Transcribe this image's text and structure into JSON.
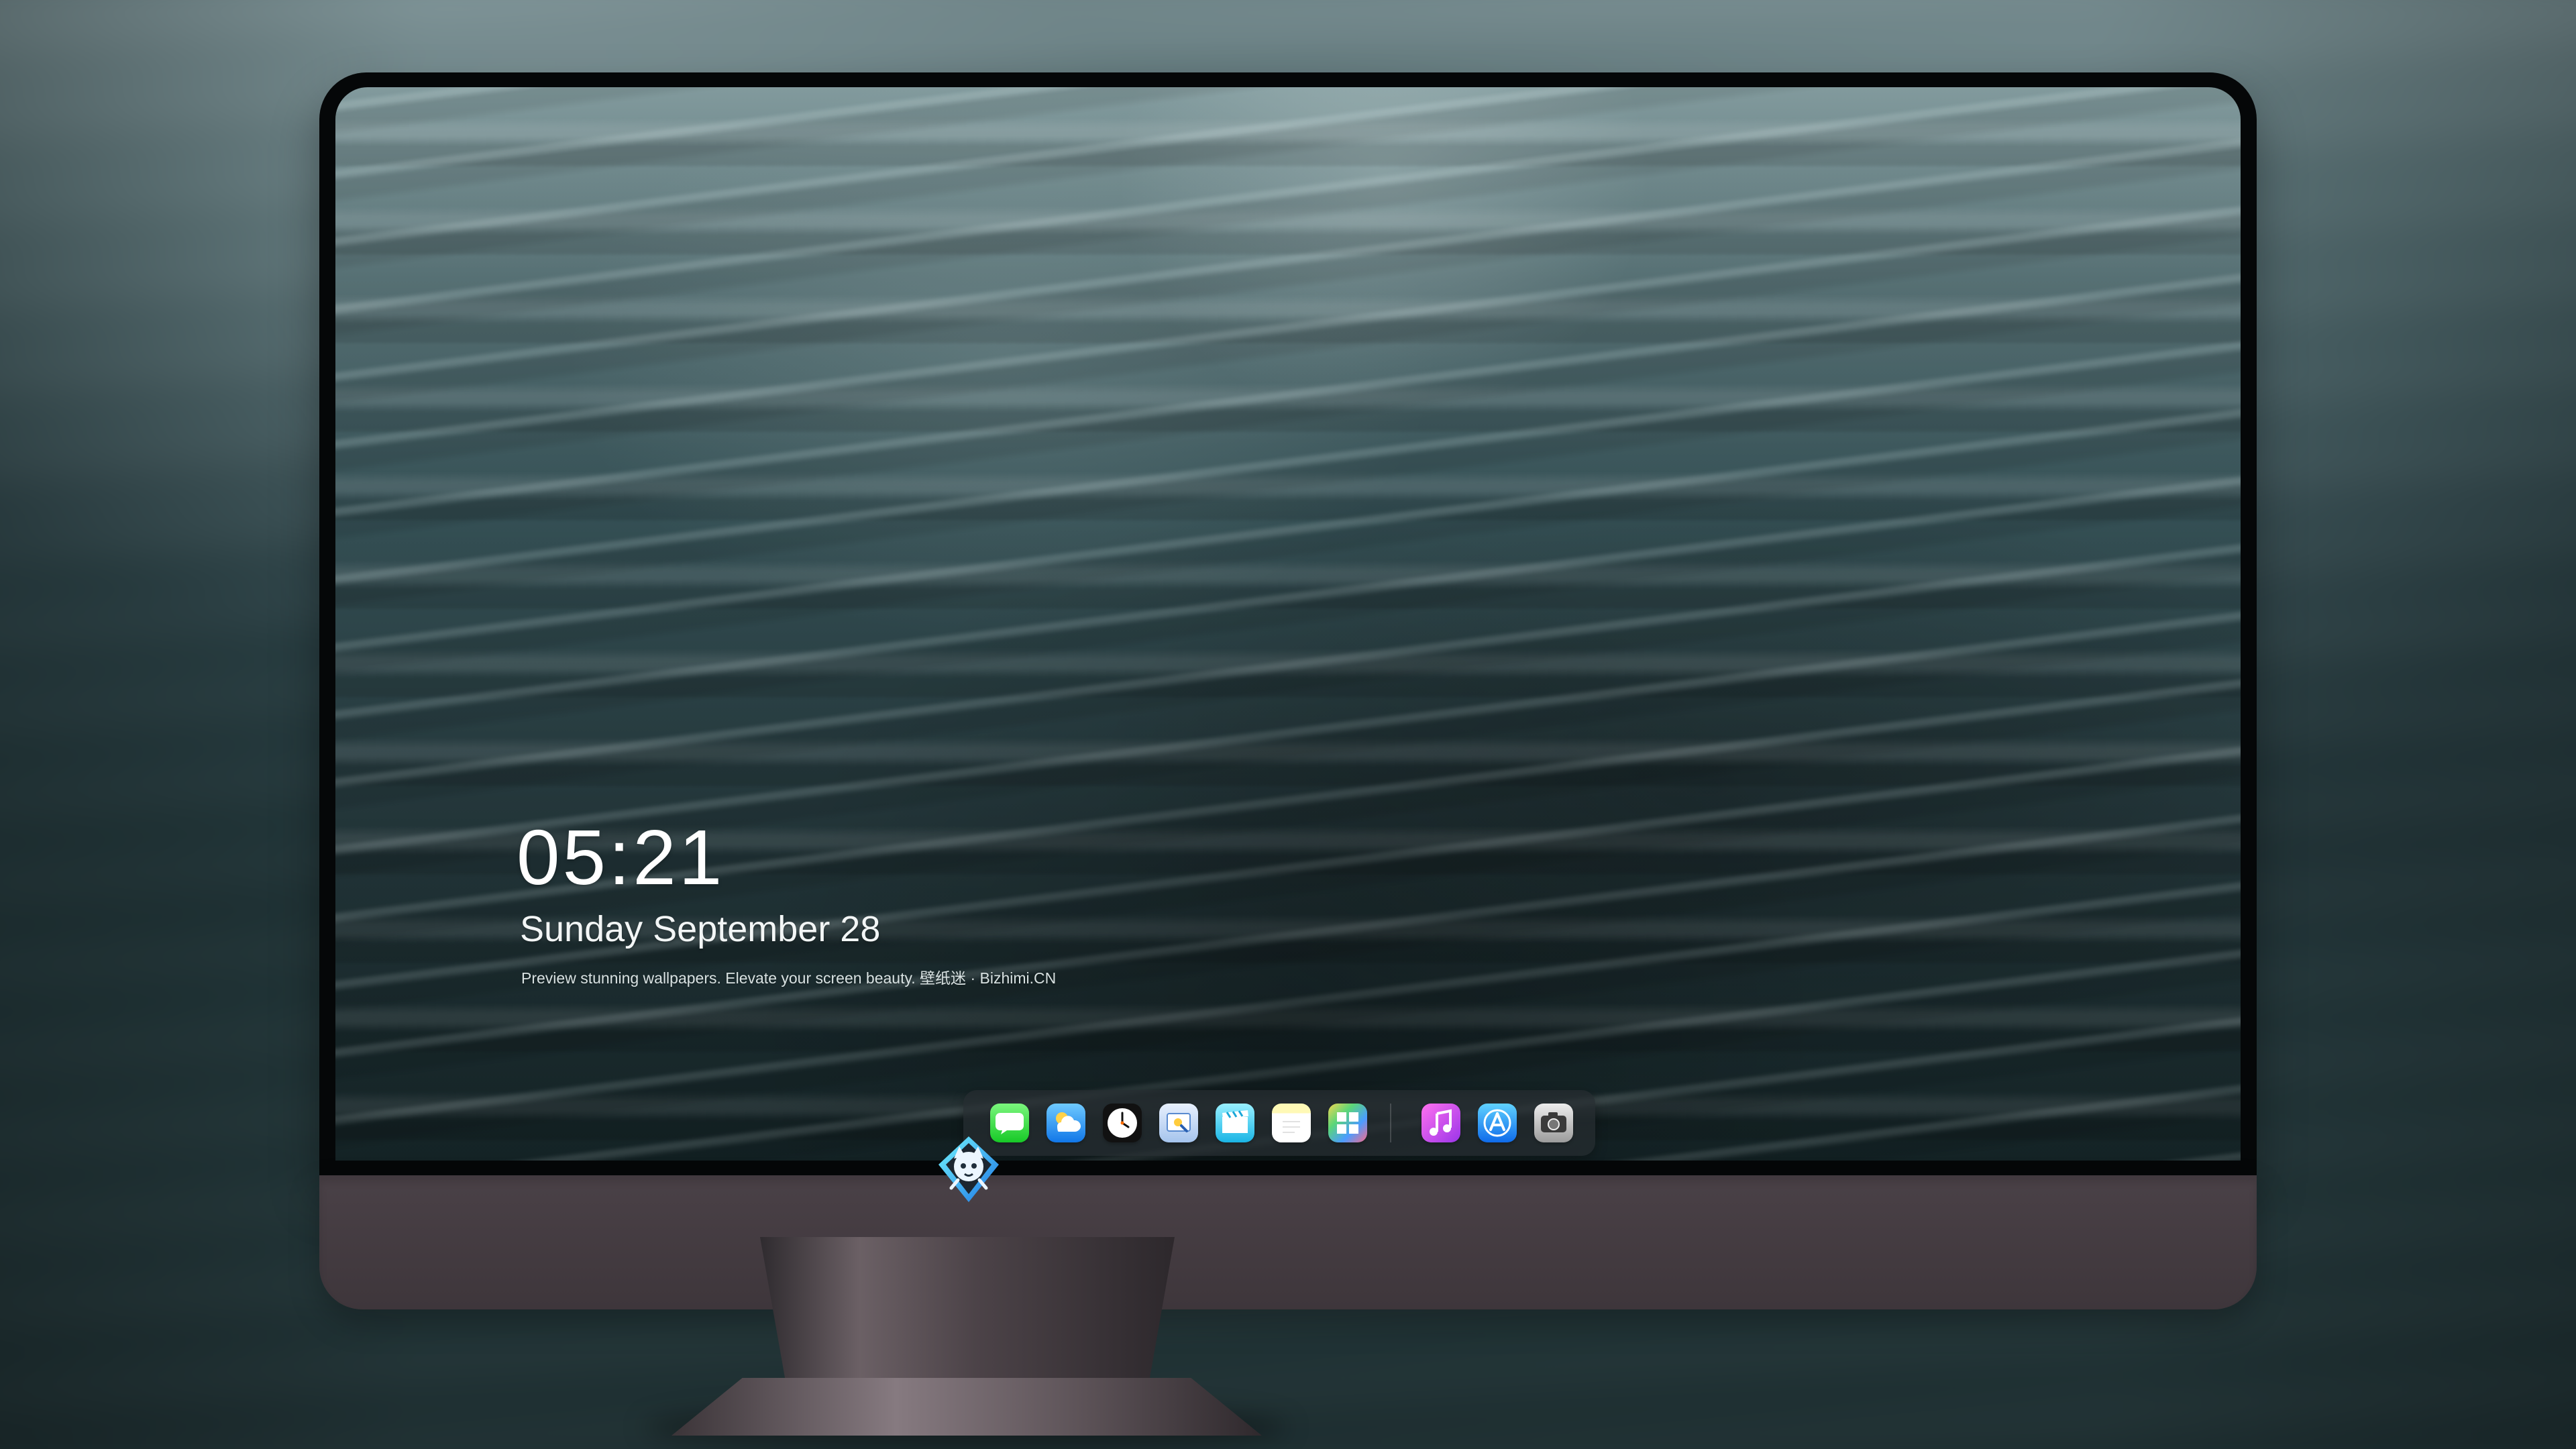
{
  "lock_screen": {
    "time": "05:21",
    "date": "Sunday September  28",
    "caption": "Preview stunning wallpapers. Elevate your screen beauty. 壁纸迷 · Bizhimi.CN"
  },
  "dock": {
    "apps": [
      {
        "name": "messages-icon",
        "color": "#24D336"
      },
      {
        "name": "weather-icon",
        "color": "#2A8DF2"
      },
      {
        "name": "clock-icon",
        "color": "#111111"
      },
      {
        "name": "preview-icon",
        "color": "#D8E6FB"
      },
      {
        "name": "clips-icon",
        "color": "#30C4EA"
      },
      {
        "name": "notes-icon",
        "color": "#FFF0A0"
      },
      {
        "name": "photo-gallery-icon",
        "color": "#5BD678"
      },
      {
        "name": "music-icon",
        "color": "#C84CF0"
      },
      {
        "name": "app-store-icon",
        "color": "#1E86F0"
      },
      {
        "name": "camera-icon",
        "color": "#C8C8C8"
      }
    ]
  },
  "device": {
    "logo": "mascot-logo",
    "frame_color": "#050708",
    "chin_color": "#443B40"
  }
}
